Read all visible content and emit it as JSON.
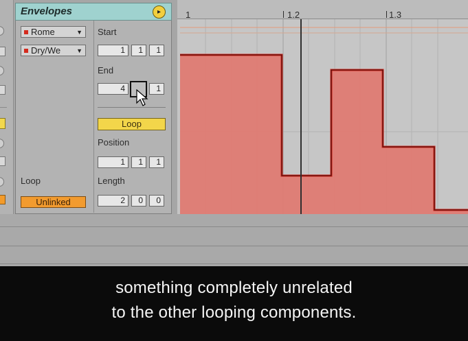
{
  "envelopes": {
    "title": "Envelopes",
    "device_chooser": "Rome",
    "control_chooser": "Dry/We",
    "loop_label": "Loop",
    "loop_mode_button": "Unlinked",
    "start": {
      "label": "Start",
      "values": [
        "1",
        "1",
        "1"
      ]
    },
    "end": {
      "label": "End",
      "values": [
        "4",
        "",
        "1"
      ]
    },
    "loop_toggle": "Loop",
    "position": {
      "label": "Position",
      "values": [
        "1",
        "1",
        "1"
      ]
    },
    "length": {
      "label": "Length",
      "values": [
        "2",
        "0",
        "0"
      ]
    }
  },
  "ruler": {
    "ticks": [
      "1",
      "1.2",
      "1.3"
    ]
  },
  "subtitle": {
    "line1": "something completely unrelated",
    "line2": "to the other looping components."
  },
  "colors": {
    "env_header": "#9fd2cf",
    "loop_button": "#f3d64a",
    "unlinked_button": "#f29b2f",
    "envelope_fill": "#e27b73",
    "envelope_line": "#d0271c"
  }
}
